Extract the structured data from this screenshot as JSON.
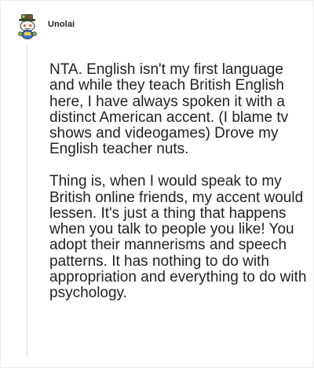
{
  "comment": {
    "author": "Unolai",
    "avatar_icon": "snoo-avatar-icon",
    "paragraphs": [
      "NTA. English isn't my first language and while they teach British English here, I have always spoken it with a distinct American accent. (I blame tv shows and videogames) Drove my English teacher nuts.",
      "Thing is, when I would speak to my British online friends, my accent would lessen. It's just a thing that happens when you talk to people you like! You adopt their mannerisms and speech patterns. It has nothing to do with appropriation and everything to do with psychology."
    ]
  }
}
